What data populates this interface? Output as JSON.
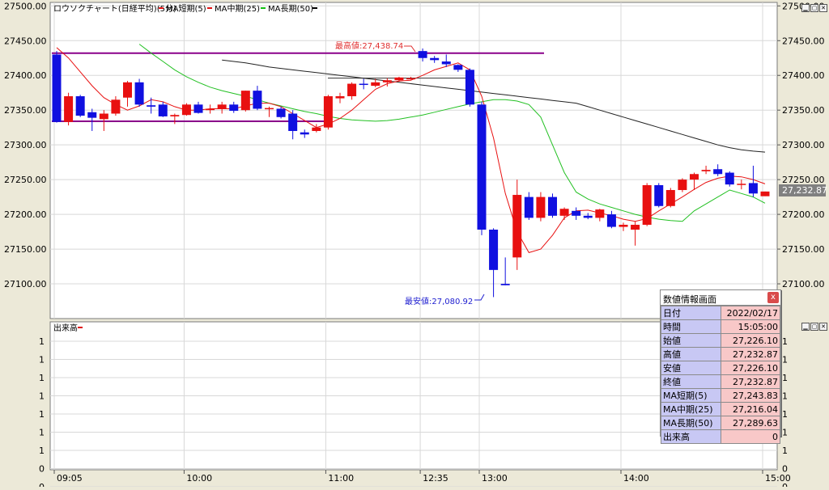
{
  "window": {
    "title": "ロウソクチャート(日経平均)(5分)",
    "legend": [
      {
        "label": "MA短期(5)",
        "color": "#e01010"
      },
      {
        "label": "MA中期(25)",
        "color": "#e01010"
      },
      {
        "label": "MA長期(50)",
        "color": "#10c010"
      },
      {
        "label": "",
        "color": "#000000"
      }
    ],
    "last_price_tag": "27,232.87"
  },
  "colors": {
    "up": "#e81010",
    "down": "#1010e0",
    "ma5": "#e81010",
    "ma25": "#22c022",
    "ma50": "#222222",
    "range": "#8a008a",
    "background": "#ffffff",
    "frame": "#ece9d8"
  },
  "annotations": {
    "high": "最高値:27,438.74",
    "low": "最安値:27,080.92"
  },
  "volume_panel": {
    "title": "出来高",
    "ticks": [
      "1",
      "1",
      "1",
      "1",
      "1",
      "1",
      "1",
      "0",
      "0",
      "0"
    ]
  },
  "info_panel": {
    "title": "数値情報画面",
    "close": "x",
    "rows": [
      {
        "key": "日付",
        "value": "2022/02/17"
      },
      {
        "key": "時間",
        "value": "15:05:00"
      },
      {
        "key": "始値",
        "value": "27,226.10"
      },
      {
        "key": "高値",
        "value": "27,232.87"
      },
      {
        "key": "安値",
        "value": "27,226.10"
      },
      {
        "key": "終値",
        "value": "27,232.87"
      },
      {
        "key": "MA短期(5)",
        "value": "27,243.83"
      },
      {
        "key": "MA中期(25)",
        "value": "27,216.04"
      },
      {
        "key": "MA長期(50)",
        "value": "27,289.63"
      },
      {
        "key": "出来高",
        "value": "0"
      }
    ]
  },
  "chart_data": {
    "type": "candlestick",
    "title": "ロウソクチャート(日経平均)(5分)",
    "ylim": [
      27050,
      27505
    ],
    "y_ticks_left": [
      "27500.00",
      "27450.00",
      "27400.00",
      "27350.00",
      "27300.00",
      "27250.00",
      "27200.00",
      "27150.00",
      "27100.00"
    ],
    "y_ticks_right": [
      "27500.00",
      "27450.00",
      "27400.00",
      "27350.00",
      "27300.00",
      "27250.00",
      "27200.00",
      "27150.00",
      "27100.00"
    ],
    "y_tick_values": [
      27500,
      27450,
      27400,
      27350,
      27300,
      27250,
      27200,
      27150,
      27100
    ],
    "x_labels": [
      {
        "label": "09:05",
        "index": 0
      },
      {
        "label": "10:00",
        "index": 11
      },
      {
        "label": "11:00",
        "index": 23
      },
      {
        "label": "12:35",
        "index": 31
      },
      {
        "label": "13:00",
        "index": 36
      },
      {
        "label": "14:00",
        "index": 48
      },
      {
        "label": "15:00",
        "index": 60
      }
    ],
    "candles": [
      {
        "o": 27430,
        "h": 27435,
        "l": 27332,
        "c": 27333
      },
      {
        "o": 27333,
        "h": 27375,
        "l": 27328,
        "c": 27370
      },
      {
        "o": 27370,
        "h": 27372,
        "l": 27340,
        "c": 27342
      },
      {
        "o": 27347,
        "h": 27352,
        "l": 27320,
        "c": 27339
      },
      {
        "o": 27337,
        "h": 27350,
        "l": 27320,
        "c": 27345
      },
      {
        "o": 27345,
        "h": 27370,
        "l": 27342,
        "c": 27365
      },
      {
        "o": 27368,
        "h": 27392,
        "l": 27355,
        "c": 27390
      },
      {
        "o": 27390,
        "h": 27395,
        "l": 27355,
        "c": 27358
      },
      {
        "o": 27357,
        "h": 27368,
        "l": 27345,
        "c": 27355
      },
      {
        "o": 27358,
        "h": 27362,
        "l": 27340,
        "c": 27341
      },
      {
        "o": 27341,
        "h": 27345,
        "l": 27330,
        "c": 27343
      },
      {
        "o": 27343,
        "h": 27360,
        "l": 27342,
        "c": 27358
      },
      {
        "o": 27358,
        "h": 27362,
        "l": 27345,
        "c": 27346
      },
      {
        "o": 27350,
        "h": 27358,
        "l": 27345,
        "c": 27352
      },
      {
        "o": 27352,
        "h": 27362,
        "l": 27345,
        "c": 27358
      },
      {
        "o": 27358,
        "h": 27362,
        "l": 27346,
        "c": 27349
      },
      {
        "o": 27350,
        "h": 27378,
        "l": 27348,
        "c": 27378
      },
      {
        "o": 27378,
        "h": 27385,
        "l": 27350,
        "c": 27352
      },
      {
        "o": 27352,
        "h": 27355,
        "l": 27340,
        "c": 27353
      },
      {
        "o": 27352,
        "h": 27355,
        "l": 27338,
        "c": 27340
      },
      {
        "o": 27345,
        "h": 27350,
        "l": 27308,
        "c": 27320
      },
      {
        "o": 27318,
        "h": 27322,
        "l": 27310,
        "c": 27315
      },
      {
        "o": 27320,
        "h": 27330,
        "l": 27318,
        "c": 27325
      },
      {
        "o": 27325,
        "h": 27372,
        "l": 27322,
        "c": 27370
      },
      {
        "o": 27367,
        "h": 27375,
        "l": 27360,
        "c": 27370
      },
      {
        "o": 27370,
        "h": 27390,
        "l": 27365,
        "c": 27388
      },
      {
        "o": 27388,
        "h": 27395,
        "l": 27380,
        "c": 27387
      },
      {
        "o": 27385,
        "h": 27395,
        "l": 27383,
        "c": 27390
      },
      {
        "o": 27390,
        "h": 27396,
        "l": 27384,
        "c": 27393
      },
      {
        "o": 27393,
        "h": 27398,
        "l": 27391,
        "c": 27397
      },
      {
        "o": 27396,
        "h": 27398,
        "l": 27394,
        "c": 27396
      },
      {
        "o": 27435,
        "h": 27438.74,
        "l": 27420,
        "c": 27425
      },
      {
        "o": 27425,
        "h": 27428,
        "l": 27418,
        "c": 27422
      },
      {
        "o": 27420,
        "h": 27430,
        "l": 27412,
        "c": 27416
      },
      {
        "o": 27415,
        "h": 27416,
        "l": 27405,
        "c": 27408
      },
      {
        "o": 27408,
        "h": 27410,
        "l": 27355,
        "c": 27358
      },
      {
        "o": 27358,
        "h": 27362,
        "l": 27170,
        "c": 27178
      },
      {
        "o": 27178,
        "h": 27180,
        "l": 27080.92,
        "c": 27120
      },
      {
        "o": 27100,
        "h": 27138,
        "l": 27098,
        "c": 27098
      },
      {
        "o": 27138,
        "h": 27250,
        "l": 27120,
        "c": 27228
      },
      {
        "o": 27225,
        "h": 27232,
        "l": 27192,
        "c": 27195
      },
      {
        "o": 27195,
        "h": 27232,
        "l": 27190,
        "c": 27225
      },
      {
        "o": 27225,
        "h": 27230,
        "l": 27195,
        "c": 27198
      },
      {
        "o": 27198,
        "h": 27210,
        "l": 27192,
        "c": 27208
      },
      {
        "o": 27205,
        "h": 27210,
        "l": 27192,
        "c": 27198
      },
      {
        "o": 27198,
        "h": 27202,
        "l": 27193,
        "c": 27195
      },
      {
        "o": 27195,
        "h": 27208,
        "l": 27190,
        "c": 27207
      },
      {
        "o": 27200,
        "h": 27205,
        "l": 27180,
        "c": 27182
      },
      {
        "o": 27182,
        "h": 27188,
        "l": 27176,
        "c": 27185
      },
      {
        "o": 27178,
        "h": 27190,
        "l": 27155,
        "c": 27185
      },
      {
        "o": 27185,
        "h": 27245,
        "l": 27183,
        "c": 27242
      },
      {
        "o": 27242,
        "h": 27245,
        "l": 27210,
        "c": 27212
      },
      {
        "o": 27212,
        "h": 27238,
        "l": 27210,
        "c": 27235
      },
      {
        "o": 27235,
        "h": 27252,
        "l": 27232,
        "c": 27250
      },
      {
        "o": 27250,
        "h": 27260,
        "l": 27235,
        "c": 27258
      },
      {
        "o": 27262,
        "h": 27270,
        "l": 27258,
        "c": 27264
      },
      {
        "o": 27265,
        "h": 27272,
        "l": 27255,
        "c": 27258
      },
      {
        "o": 27260,
        "h": 27262,
        "l": 27240,
        "c": 27243
      },
      {
        "o": 27243,
        "h": 27250,
        "l": 27236,
        "c": 27244
      },
      {
        "o": 27245,
        "h": 27270,
        "l": 27225,
        "c": 27230
      },
      {
        "o": 27226.1,
        "h": 27232.87,
        "l": 27226.1,
        "c": 27232.87
      }
    ],
    "ma_short_5": [
      27440,
      27425,
      27405,
      27385,
      27368,
      27358,
      27350,
      27356,
      27365,
      27362,
      27355,
      27350,
      27350,
      27352,
      27352,
      27352,
      27356,
      27360,
      27360,
      27355,
      27345,
      27335,
      27325,
      27330,
      27338,
      27350,
      27365,
      27380,
      27388,
      27392,
      27393,
      27400,
      27408,
      27413,
      27418,
      27408,
      27370,
      27310,
      27230,
      27175,
      27145,
      27150,
      27170,
      27195,
      27205,
      27206,
      27202,
      27198,
      27193,
      27190,
      27194,
      27205,
      27215,
      27225,
      27236,
      27246,
      27252,
      27255,
      27254,
      27250,
      27243.83
    ],
    "ma_medium_25": [
      27445,
      27432,
      27420,
      27408,
      27398,
      27390,
      27383,
      27378,
      27374,
      27370,
      27365,
      27360,
      27356,
      27352,
      27348,
      27345,
      27341,
      27338,
      27336,
      27335,
      27334,
      27335,
      27337,
      27340,
      27343,
      27347,
      27351,
      27355,
      27359,
      27362,
      27365,
      27365,
      27363,
      27358,
      27340,
      27300,
      27260,
      27232,
      27222,
      27215,
      27210,
      27205,
      27200,
      27196,
      27193,
      27191,
      27190,
      27205,
      27215,
      27225,
      27235,
      27230,
      27225,
      27216.04
    ],
    "ma_long_50": [
      27422,
      27420,
      27418,
      27415,
      27412,
      27410,
      27408,
      27406,
      27404,
      27402,
      27400,
      27398,
      27396,
      27394,
      27392,
      27390,
      27388,
      27386,
      27384,
      27382,
      27380,
      27378,
      27376,
      27374,
      27372,
      27370,
      27368,
      27366,
      27364,
      27362,
      27360,
      27355,
      27350,
      27345,
      27340,
      27335,
      27330,
      27325,
      27320,
      27315,
      27310,
      27305,
      27300,
      27296,
      27293,
      27291,
      27289.63
    ],
    "range_box": {
      "high": 27432,
      "low": 27334
    },
    "volume": [
      0
    ]
  }
}
